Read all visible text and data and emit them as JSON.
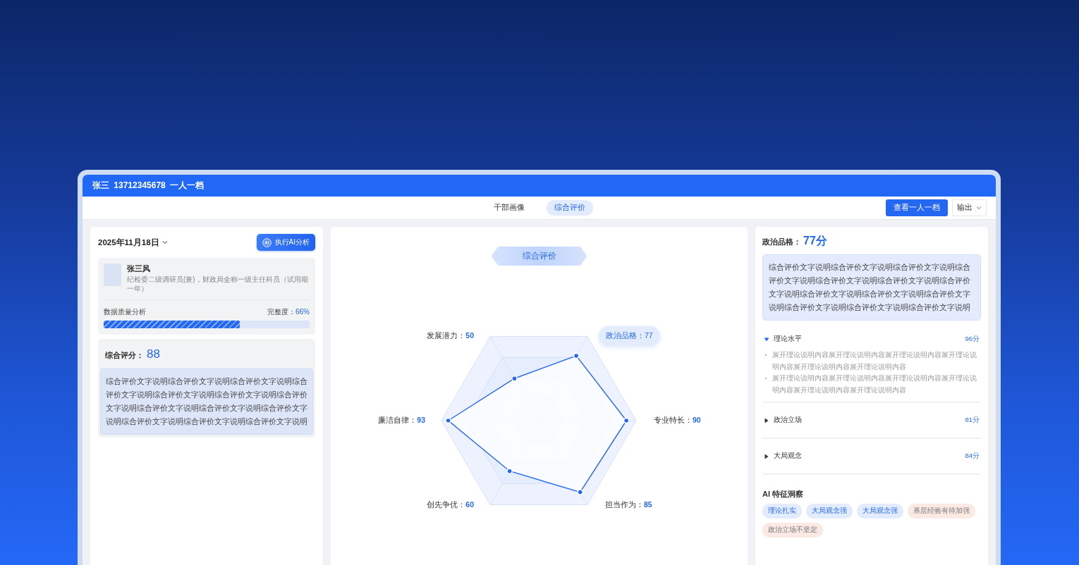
{
  "window": {
    "title": "张三 13712345678 一人一档"
  },
  "tabs": [
    {
      "label": "干部画像",
      "selected": false
    },
    {
      "label": "综合评价",
      "selected": true
    }
  ],
  "actions": {
    "primary": "查看一人一档",
    "export": "输出"
  },
  "left": {
    "date": "2025年11月18日",
    "ai_button": "执行AI分析",
    "profile": {
      "name": "张三风",
      "position": "纪检委二级调研员(兼)，财政局全称一级主任科员（试用期一年）"
    },
    "quality": {
      "label": "数据质量分析",
      "completeness_label": "完整度：",
      "completeness": "66%",
      "level": 0.66
    },
    "score": {
      "label": "综合评分：",
      "value": "88",
      "text": "综合评价文字说明综合评价文字说明综合评价文字说明综合评价文字说明综合评价文字说明综合评价文字说明综合评价文字说明综合评价文字说明综合评价文字说明综合评价文字说明综合评价文字说明综合评价文字说明综合评价文字说明"
    }
  },
  "center": {
    "title": "综合评价",
    "radar": {
      "axes": [
        {
          "label": "发展潜力：",
          "value": "50",
          "selected": false
        },
        {
          "label": "政治品格：",
          "value": "77",
          "selected": true
        },
        {
          "label": "廉洁自律：",
          "value": "93",
          "selected": false
        },
        {
          "label": "专业特长：",
          "value": "90",
          "selected": false
        },
        {
          "label": "创先争优：",
          "value": "60",
          "selected": false
        },
        {
          "label": "担当作为：",
          "value": "85",
          "selected": false
        }
      ]
    }
  },
  "right": {
    "heading": {
      "label": "政治品格：",
      "value": "77分"
    },
    "summary": "综合评价文字说明综合评价文字说明综合评价文字说明综合评价文字说明综合评价文字说明综合评价文字说明综合评价文字说明综合评价文字说明综合评价文字说明综合评价文字说明综合评价文字说明综合评价文字说明综合评价文字说明",
    "sections": [
      {
        "title": "理论水平",
        "score": "96分",
        "expanded": true,
        "points": [
          "展开理论说明内容展开理论说明内容展开理论说明内容展开理论说明内容展开理论说明内容展开理论说明内容",
          "展开理论说明内容展开理论说明内容展开理论说明内容展开理论说明内容展开理论说明内容展开理论说明内容"
        ]
      },
      {
        "title": "政治立场",
        "score": "81分",
        "expanded": false
      },
      {
        "title": "大局观念",
        "score": "84分",
        "expanded": false
      }
    ],
    "insights": {
      "title": "AI 特征洞察",
      "tags": [
        {
          "label": "理论扎实",
          "kind": "strength"
        },
        {
          "label": "大局观念强",
          "kind": "strength"
        },
        {
          "label": "大局观念强",
          "kind": "strength"
        },
        {
          "label": "基层经验有待加强",
          "kind": "weakness"
        },
        {
          "label": "政治立场不坚定",
          "kind": "weakness"
        }
      ]
    }
  }
}
